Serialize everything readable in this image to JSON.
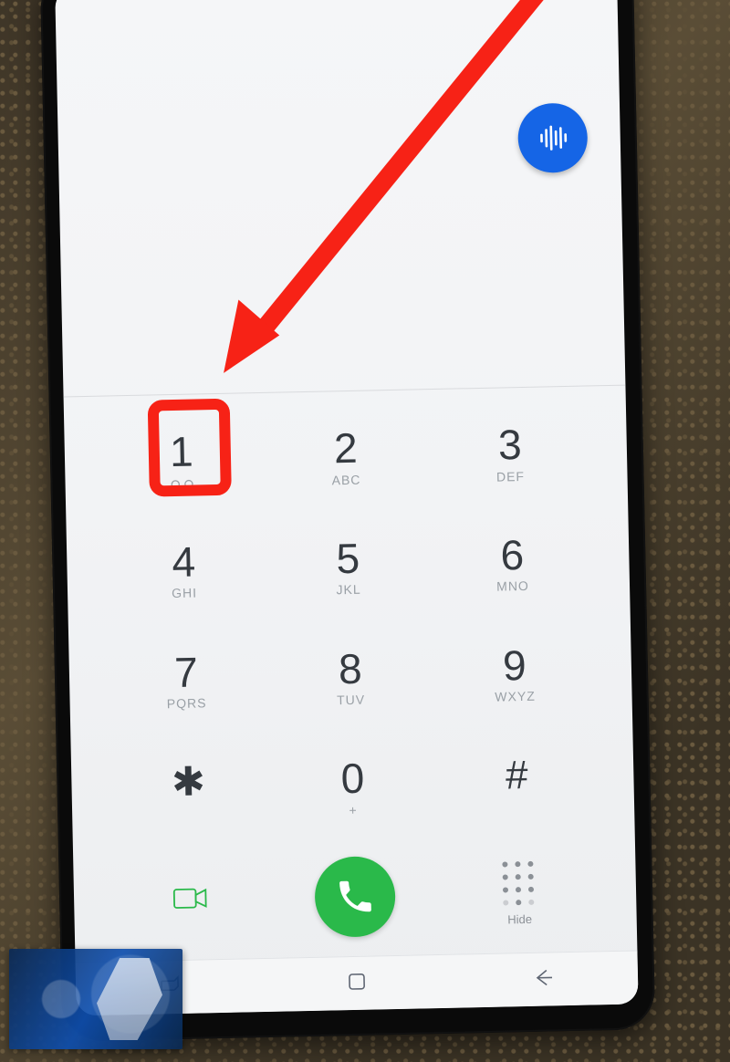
{
  "fab": {
    "icon": "voice-wave-icon"
  },
  "keypad": {
    "rows": [
      [
        {
          "digit": "1",
          "sub": "voicemail-icon",
          "name": "key-1",
          "highlight": true
        },
        {
          "digit": "2",
          "sub": "ABC",
          "name": "key-2"
        },
        {
          "digit": "3",
          "sub": "DEF",
          "name": "key-3"
        }
      ],
      [
        {
          "digit": "4",
          "sub": "GHI",
          "name": "key-4"
        },
        {
          "digit": "5",
          "sub": "JKL",
          "name": "key-5"
        },
        {
          "digit": "6",
          "sub": "MNO",
          "name": "key-6"
        }
      ],
      [
        {
          "digit": "7",
          "sub": "PQRS",
          "name": "key-7"
        },
        {
          "digit": "8",
          "sub": "TUV",
          "name": "key-8"
        },
        {
          "digit": "9",
          "sub": "WXYZ",
          "name": "key-9"
        }
      ],
      [
        {
          "digit": "*",
          "sub": "",
          "name": "key-star",
          "sym": true,
          "glyph": "✱"
        },
        {
          "digit": "0",
          "sub": "+",
          "name": "key-0"
        },
        {
          "digit": "#",
          "sub": "",
          "name": "key-hash",
          "sym": true
        }
      ]
    ]
  },
  "actions": {
    "video": "video-call-icon",
    "call": "call-icon",
    "hide_label": "Hide"
  },
  "nav": {
    "recents": "recents-icon",
    "home": "home-icon",
    "back": "back-icon"
  },
  "annotation": {
    "arrow": "red-arrow",
    "highlight_target": "key-1"
  }
}
